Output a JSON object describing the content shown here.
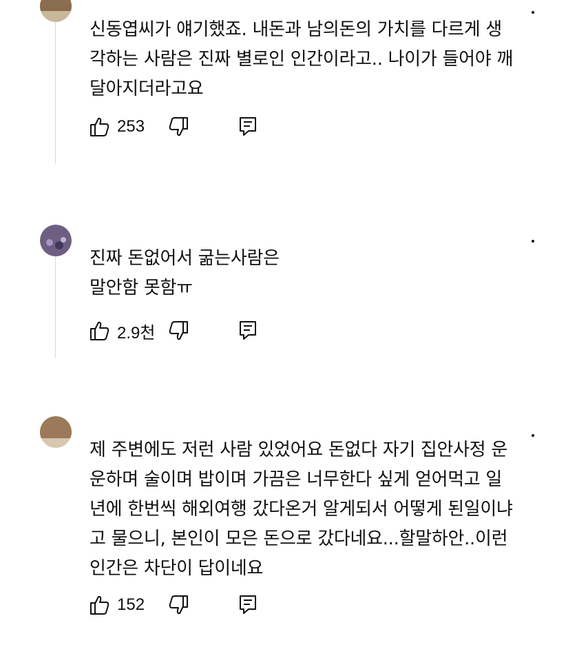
{
  "comments": [
    {
      "text": "신동엽씨가 얘기했죠. 내돈과 남의돈의 가치를 다르게 생\n각하는 사람은 진짜 별로인 인간이라고.. 나이가 들어야 깨\n달아지더라고요",
      "likes": "253",
      "avatar_color": "#8a6d4e"
    },
    {
      "text": "진짜 돈없어서 굶는사람은\n말안함 못함ㅠ",
      "likes": "2.9천",
      "avatar_color": "#5b4a6e"
    },
    {
      "text": "제 주변에도 저런 사람 있었어요 돈없다 자기 집안사정 운\n운하며 술이며 밥이며 가끔은 너무한다 싶게 얻어먹고 일\n년에 한번씩 해외여행 갔다온거 알게되서 어떻게 된일이냐\n고 물으니, 본인이 모은 돈으로 갔다네요...할말하안..이런\n인간은 차단이 답이네요",
      "likes": "152",
      "avatar_color": "#9a7a5a"
    }
  ],
  "icons": {
    "like": "thumbs-up-icon",
    "dislike": "thumbs-down-icon",
    "reply": "reply-icon",
    "menu": "more-vertical-icon"
  },
  "colors": {
    "text": "#0f0f0f",
    "thread_line": "#d9d9d9",
    "background": "#ffffff"
  }
}
